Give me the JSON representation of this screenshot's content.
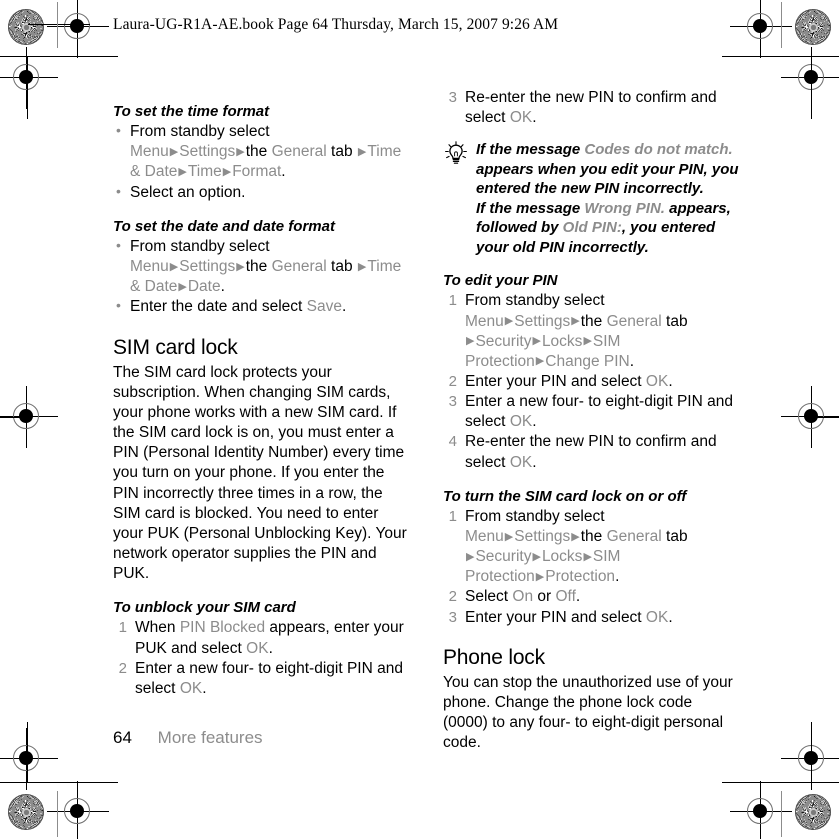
{
  "running_header": "Laura-UG-R1A-AE.book  Page 64  Thursday, March 15, 2007  9:26 AM",
  "colors": {
    "body_text": "#000000",
    "ui_term_gray": "#8c8c8c",
    "page_background": "#ffffff"
  },
  "footer": {
    "page_number": "64",
    "section_name": "More features"
  },
  "left_column": {
    "section_time_format": {
      "heading": "To set the time format",
      "bullets": [
        {
          "parts": [
            {
              "text": "From standby select ",
              "style": "plain"
            },
            {
              "text": "Menu",
              "style": "gray"
            },
            {
              "text": "▶",
              "style": "arrow"
            },
            {
              "text": "Settings",
              "style": "gray"
            },
            {
              "text": "▶",
              "style": "arrow"
            },
            {
              "text": "the ",
              "style": "plain"
            },
            {
              "text": "General",
              "style": "gray"
            },
            {
              "text": " tab ",
              "style": "plain"
            },
            {
              "text": "▶",
              "style": "arrow"
            },
            {
              "text": "Time & Date",
              "style": "gray"
            },
            {
              "text": "▶",
              "style": "arrow"
            },
            {
              "text": "Time",
              "style": "gray"
            },
            {
              "text": "▶",
              "style": "arrow"
            },
            {
              "text": "Format",
              "style": "gray"
            },
            {
              "text": ".",
              "style": "plain"
            }
          ]
        },
        {
          "parts": [
            {
              "text": "Select an option.",
              "style": "plain"
            }
          ]
        }
      ]
    },
    "section_date_format": {
      "heading": "To set the date and date format",
      "bullets": [
        {
          "parts": [
            {
              "text": "From standby select ",
              "style": "plain"
            },
            {
              "text": "Menu",
              "style": "gray"
            },
            {
              "text": "▶",
              "style": "arrow"
            },
            {
              "text": "Settings",
              "style": "gray"
            },
            {
              "text": "▶",
              "style": "arrow"
            },
            {
              "text": "the ",
              "style": "plain"
            },
            {
              "text": "General",
              "style": "gray"
            },
            {
              "text": " tab ",
              "style": "plain"
            },
            {
              "text": "▶",
              "style": "arrow"
            },
            {
              "text": "Time & Date",
              "style": "gray"
            },
            {
              "text": "▶",
              "style": "arrow"
            },
            {
              "text": "Date",
              "style": "gray"
            },
            {
              "text": ".",
              "style": "plain"
            }
          ]
        },
        {
          "parts": [
            {
              "text": "Enter the date and select ",
              "style": "plain"
            },
            {
              "text": "Save",
              "style": "gray"
            },
            {
              "text": ".",
              "style": "plain"
            }
          ]
        }
      ]
    },
    "section_sim_card_lock": {
      "heading": "SIM card lock",
      "paragraph": "The SIM card lock protects your subscription. When changing SIM cards, your phone works with a new SIM card. If the SIM card lock is on, you must enter a PIN (Personal Identity Number) every time you turn on your phone. If you enter the PIN incorrectly three times in a row, the SIM card is blocked. You need to enter your PUK (Personal Unblocking Key). Your network operator supplies the PIN and PUK."
    },
    "section_unblock_sim": {
      "heading": "To unblock your SIM card",
      "steps": [
        {
          "parts": [
            {
              "text": "When ",
              "style": "plain"
            },
            {
              "text": "PIN Blocked",
              "style": "gray"
            },
            {
              "text": " appears, enter your PUK and select ",
              "style": "plain"
            },
            {
              "text": "OK",
              "style": "gray"
            },
            {
              "text": ".",
              "style": "plain"
            }
          ]
        },
        {
          "parts": [
            {
              "text": "Enter a new four- to eight-digit PIN and select ",
              "style": "plain"
            },
            {
              "text": "OK",
              "style": "gray"
            },
            {
              "text": ".",
              "style": "plain"
            }
          ]
        }
      ]
    }
  },
  "right_column": {
    "continued_steps": {
      "start_number": 3,
      "steps": [
        {
          "parts": [
            {
              "text": "Re-enter the new PIN to confirm and select ",
              "style": "plain"
            },
            {
              "text": "OK",
              "style": "gray"
            },
            {
              "text": ".",
              "style": "plain"
            }
          ]
        }
      ]
    },
    "tip": {
      "icon": "lightbulb-tip-icon",
      "parts": [
        {
          "text": "If the message ",
          "style": "plain"
        },
        {
          "text": "Codes do not match.",
          "style": "gray"
        },
        {
          "text": " appears when you edit your PIN, you entered the new PIN incorrectly.",
          "style": "plain"
        },
        {
          "text": "\n",
          "style": "break"
        },
        {
          "text": "If the message ",
          "style": "plain"
        },
        {
          "text": "Wrong PIN.",
          "style": "gray"
        },
        {
          "text": " appears, followed by ",
          "style": "plain"
        },
        {
          "text": "Old PIN:",
          "style": "gray"
        },
        {
          "text": ", you entered your old PIN incorrectly.",
          "style": "plain"
        }
      ]
    },
    "section_edit_pin": {
      "heading": "To edit your PIN",
      "steps": [
        {
          "parts": [
            {
              "text": "From standby select ",
              "style": "plain"
            },
            {
              "text": "Menu",
              "style": "gray"
            },
            {
              "text": "▶",
              "style": "arrow"
            },
            {
              "text": "Settings",
              "style": "gray"
            },
            {
              "text": "▶",
              "style": "arrow"
            },
            {
              "text": "the ",
              "style": "plain"
            },
            {
              "text": "General",
              "style": "gray"
            },
            {
              "text": " tab ",
              "style": "plain"
            },
            {
              "text": "▶",
              "style": "arrow"
            },
            {
              "text": "Security",
              "style": "gray"
            },
            {
              "text": "▶",
              "style": "arrow"
            },
            {
              "text": "Locks",
              "style": "gray"
            },
            {
              "text": "▶",
              "style": "arrow"
            },
            {
              "text": "SIM Protection",
              "style": "gray"
            },
            {
              "text": "▶",
              "style": "arrow"
            },
            {
              "text": "Change PIN",
              "style": "gray"
            },
            {
              "text": ".",
              "style": "plain"
            }
          ]
        },
        {
          "parts": [
            {
              "text": "Enter your PIN and select ",
              "style": "plain"
            },
            {
              "text": "OK",
              "style": "gray"
            },
            {
              "text": ".",
              "style": "plain"
            }
          ]
        },
        {
          "parts": [
            {
              "text": "Enter a new four- to eight-digit PIN and select ",
              "style": "plain"
            },
            {
              "text": "OK",
              "style": "gray"
            },
            {
              "text": ".",
              "style": "plain"
            }
          ]
        },
        {
          "parts": [
            {
              "text": "Re-enter the new PIN to confirm and select ",
              "style": "plain"
            },
            {
              "text": "OK",
              "style": "gray"
            },
            {
              "text": ".",
              "style": "plain"
            }
          ]
        }
      ]
    },
    "section_sim_lock_toggle": {
      "heading": "To turn the SIM card lock on or off",
      "steps": [
        {
          "parts": [
            {
              "text": "From standby select ",
              "style": "plain"
            },
            {
              "text": "Menu",
              "style": "gray"
            },
            {
              "text": "▶",
              "style": "arrow"
            },
            {
              "text": "Settings",
              "style": "gray"
            },
            {
              "text": "▶",
              "style": "arrow"
            },
            {
              "text": "the ",
              "style": "plain"
            },
            {
              "text": "General",
              "style": "gray"
            },
            {
              "text": " tab ",
              "style": "plain"
            },
            {
              "text": "▶",
              "style": "arrow"
            },
            {
              "text": "Security",
              "style": "gray"
            },
            {
              "text": "▶",
              "style": "arrow"
            },
            {
              "text": "Locks",
              "style": "gray"
            },
            {
              "text": "▶",
              "style": "arrow"
            },
            {
              "text": "SIM Protection",
              "style": "gray"
            },
            {
              "text": "▶",
              "style": "arrow"
            },
            {
              "text": "Protection",
              "style": "gray"
            },
            {
              "text": ".",
              "style": "plain"
            }
          ]
        },
        {
          "parts": [
            {
              "text": "Select ",
              "style": "plain"
            },
            {
              "text": "On",
              "style": "gray"
            },
            {
              "text": " or ",
              "style": "plain"
            },
            {
              "text": "Off",
              "style": "gray"
            },
            {
              "text": ".",
              "style": "plain"
            }
          ]
        },
        {
          "parts": [
            {
              "text": "Enter your PIN and select ",
              "style": "plain"
            },
            {
              "text": "OK",
              "style": "gray"
            },
            {
              "text": ".",
              "style": "plain"
            }
          ]
        }
      ]
    },
    "section_phone_lock": {
      "heading": "Phone lock",
      "paragraph": "You can stop the unauthorized use of your phone. Change the phone lock code (0000) to any four- to eight-digit personal code."
    }
  }
}
